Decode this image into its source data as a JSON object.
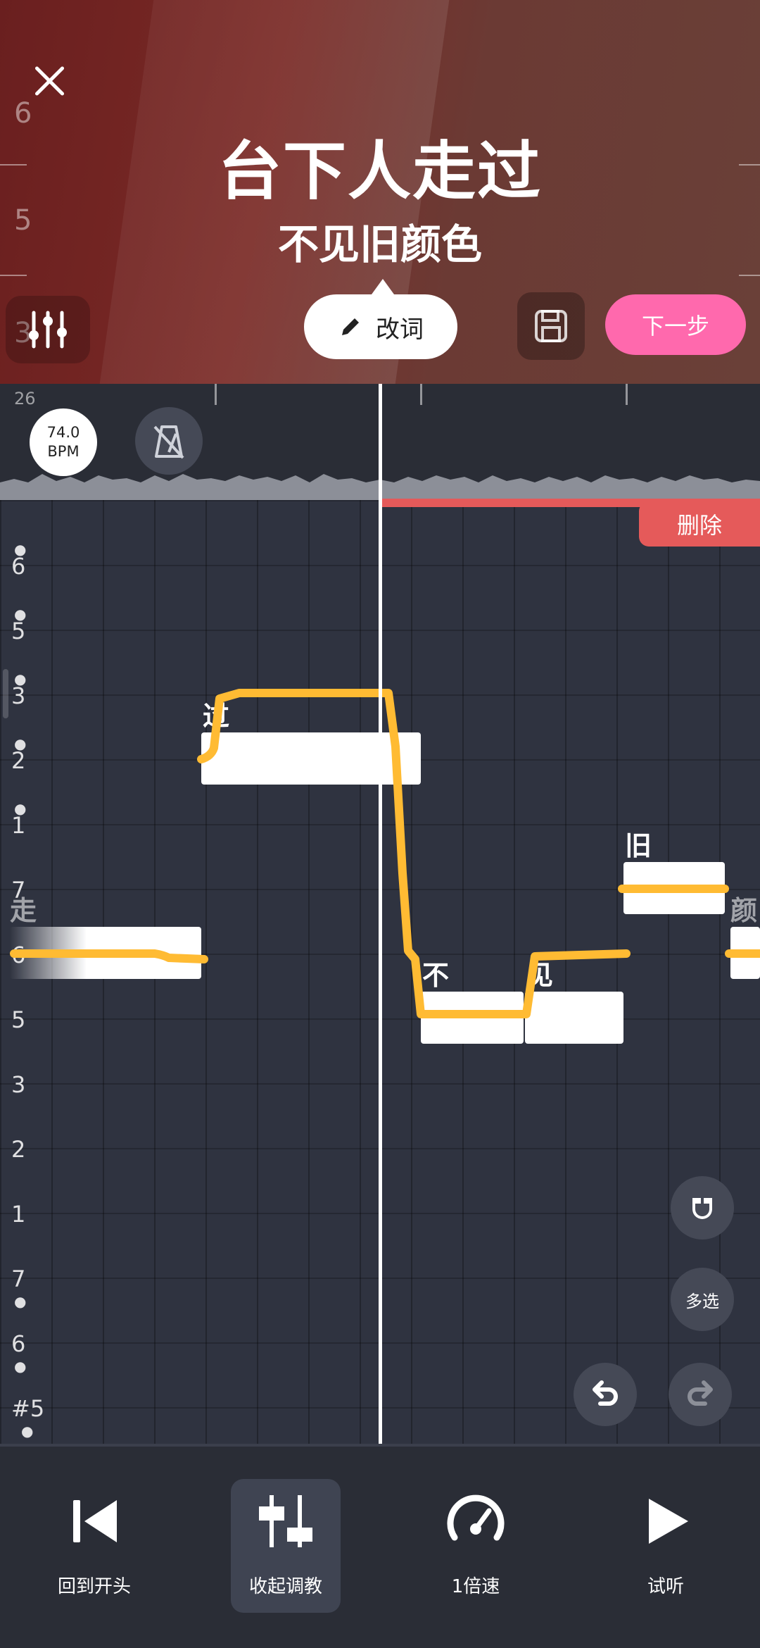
{
  "lyrics": {
    "current_line": "台下人走过",
    "next_line": "不见旧颜色"
  },
  "header": {
    "edit_lyrics_label": "改词",
    "next_step_label": "下一步",
    "scale_labels": [
      "6",
      "5",
      "3"
    ]
  },
  "timeline": {
    "bar_number": "26",
    "bpm_value": "74.0",
    "bpm_unit": "BPM"
  },
  "selection": {
    "delete_label": "删除"
  },
  "piano_scale": [
    {
      "label": "6",
      "dot_above": true
    },
    {
      "label": "5",
      "dot_above": true
    },
    {
      "label": "3",
      "dot_above": true
    },
    {
      "label": "2",
      "dot_above": true
    },
    {
      "label": "1",
      "dot_above": true
    },
    {
      "label": "7",
      "dot_above": false
    },
    {
      "label": "6",
      "dot_above": false
    },
    {
      "label": "5",
      "dot_above": false
    },
    {
      "label": "3",
      "dot_above": false
    },
    {
      "label": "2",
      "dot_above": false
    },
    {
      "label": "1",
      "dot_above": false
    },
    {
      "label": "7",
      "dot_below": true
    },
    {
      "label": "6",
      "dot_below": true
    },
    {
      "label": "#5",
      "dot_below": true
    }
  ],
  "notes": [
    {
      "lyric": "走"
    },
    {
      "lyric": "过"
    },
    {
      "lyric": "不"
    },
    {
      "lyric": "见"
    },
    {
      "lyric": "旧"
    },
    {
      "lyric": "颜"
    }
  ],
  "side_controls": {
    "multi_select_label": "多选"
  },
  "toolbar": {
    "rewind_label": "回到开头",
    "collapse_label": "收起调教",
    "speed_label": "1倍速",
    "preview_label": "试听"
  },
  "colors": {
    "accent_pink": "#ff69ad",
    "pitch_curve": "#ffbb33",
    "delete_red": "#e55a5a",
    "grid_bg": "#2f3340"
  }
}
